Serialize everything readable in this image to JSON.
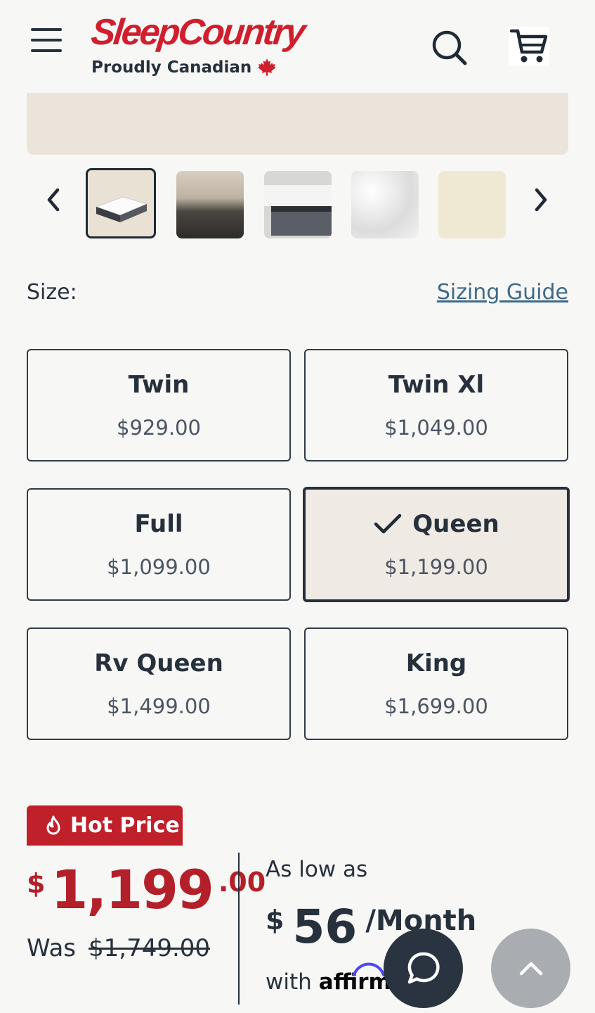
{
  "header": {
    "brand_name": "SleepCountry",
    "tagline": "Proudly Canadian",
    "icons": [
      "menu-icon",
      "maple-leaf-icon",
      "search-icon",
      "cart-icon"
    ]
  },
  "gallery": {
    "thumbnails": [
      "mattress-angle",
      "bedroom-scene",
      "mattress-edge",
      "mattress-top",
      "foam-closeup"
    ],
    "active_index": 0
  },
  "size": {
    "label": "Size:",
    "guide_link": "Sizing Guide",
    "options": [
      {
        "name": "Twin",
        "price": "$929.00"
      },
      {
        "name": "Twin Xl",
        "price": "$1,049.00"
      },
      {
        "name": "Full",
        "price": "$1,099.00"
      },
      {
        "name": "Queen",
        "price": "$1,199.00",
        "selected": true
      },
      {
        "name": "Rv Queen",
        "price": "$1,499.00"
      },
      {
        "name": "King",
        "price": "$1,699.00"
      }
    ]
  },
  "pricing": {
    "badge": "Hot Price",
    "currency": "$",
    "whole": "1,199",
    "cents": ".00",
    "was_label": "Was",
    "was_price": "$1,749.00",
    "financing_intro": "As low as",
    "monthly_currency": "$",
    "monthly_amount": "56",
    "monthly_period": "/Month",
    "with_label": "with",
    "provider": "affirm"
  },
  "colors": {
    "brand_red": "#cf1f2e",
    "price_red": "#b3202a",
    "text_dark": "#27313d",
    "link_blue": "#3e6a88",
    "selected_bg": "#efebe4"
  }
}
